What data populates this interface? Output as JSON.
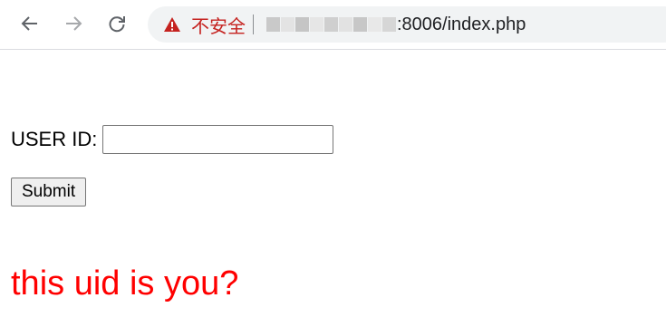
{
  "browser": {
    "security_label": "不安全",
    "url_visible": ":8006/index.php",
    "colors": {
      "warning": "#c5221f",
      "omnibox_bg": "#f1f3f4"
    },
    "icons": {
      "back": "arrow-left-icon",
      "forward": "arrow-right-icon",
      "reload": "reload-icon",
      "warning": "warning-triangle-icon"
    }
  },
  "form": {
    "user_id_label": "USER ID:",
    "user_id_value": "",
    "submit_label": "Submit"
  },
  "message": {
    "text": "this uid is you?",
    "color": "#ff0000"
  }
}
